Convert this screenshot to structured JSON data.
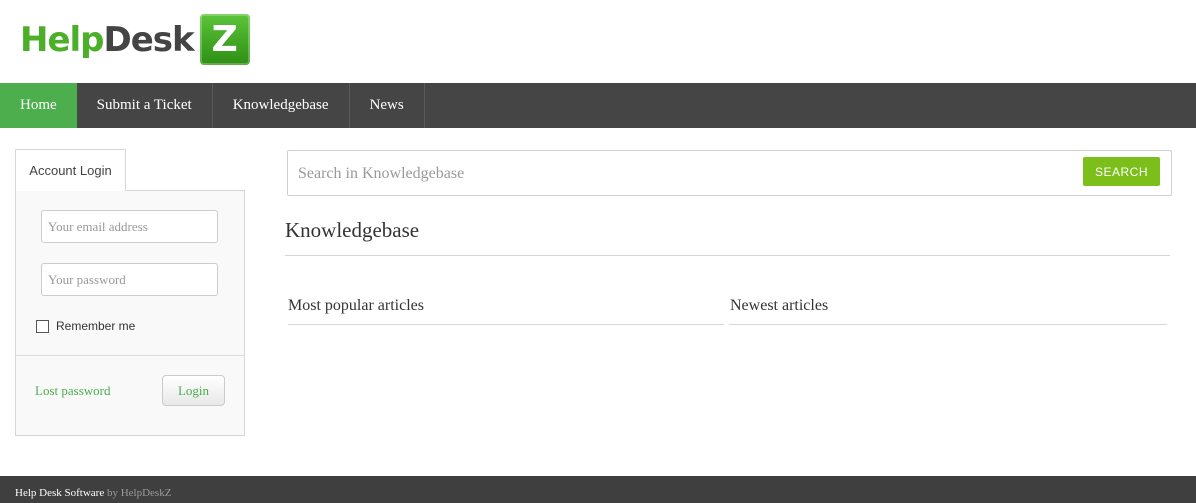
{
  "header": {
    "logo": {
      "part1": "Help",
      "part2": "Desk",
      "badge": "Z"
    }
  },
  "nav": {
    "items": [
      {
        "label": "Home",
        "active": true
      },
      {
        "label": "Submit a Ticket",
        "active": false
      },
      {
        "label": "Knowledgebase",
        "active": false
      },
      {
        "label": "News",
        "active": false
      }
    ]
  },
  "login": {
    "tab_label": "Account Login",
    "email_placeholder": "Your email address",
    "password_placeholder": "Your password",
    "remember_label": "Remember me",
    "remember_checked": false,
    "lost_password": "Lost password",
    "login_button": "Login"
  },
  "search": {
    "placeholder": "Search in Knowledgebase",
    "button": "SEARCH"
  },
  "knowledgebase": {
    "title": "Knowledgebase",
    "popular_heading": "Most popular articles",
    "newest_heading": "Newest articles"
  },
  "footer": {
    "text": "Help Desk Software",
    "by": " by HelpDeskZ"
  },
  "colors": {
    "accent": "#4cae4c",
    "search_button": "#7cbf1a",
    "nav_background": "#454545",
    "footer_background": "#3f3f3f"
  }
}
